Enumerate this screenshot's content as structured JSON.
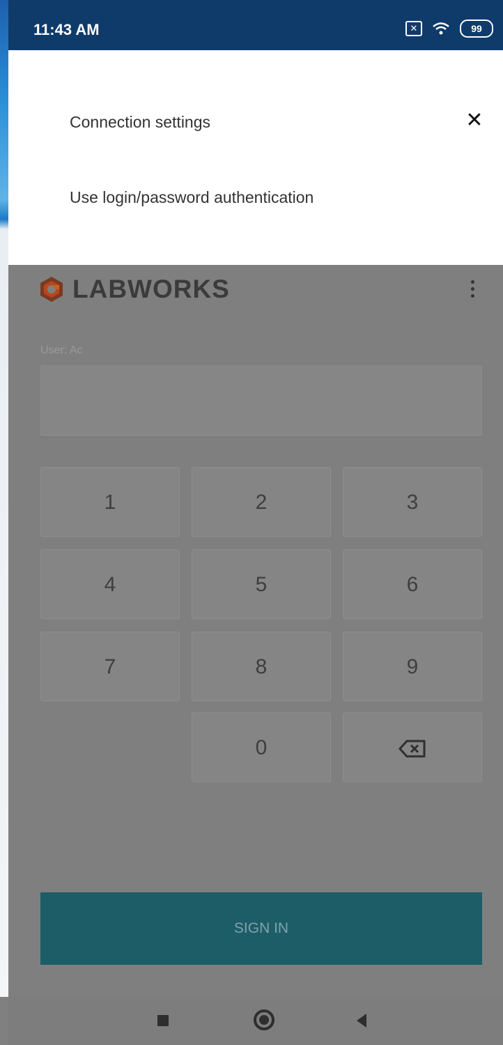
{
  "status_bar": {
    "time": "11:43 AM",
    "sim_icon": "sim-x-icon",
    "wifi_icon": "wifi-icon",
    "battery": "99"
  },
  "sheet": {
    "title": "Connection settings",
    "close_icon": "close-icon",
    "option": "Use login/password authentication"
  },
  "app": {
    "logo_text": "LABWORKS",
    "menu_icon": "more-vert-icon",
    "user_label": "User: Ac",
    "pin_value": "",
    "keys": [
      "1",
      "2",
      "3",
      "4",
      "5",
      "6",
      "7",
      "8",
      "9",
      "0"
    ],
    "backspace_icon": "backspace-icon",
    "sign_in_label": "SIGN IN"
  },
  "nav": {
    "recents_icon": "recents-icon",
    "home_icon": "home-icon",
    "back_icon": "back-icon"
  },
  "colors": {
    "status_bar": "#0f3b6b",
    "sign_in": "#1d5d68",
    "scrim": "#7f7f7f",
    "logo_orange": "#e0552b"
  }
}
